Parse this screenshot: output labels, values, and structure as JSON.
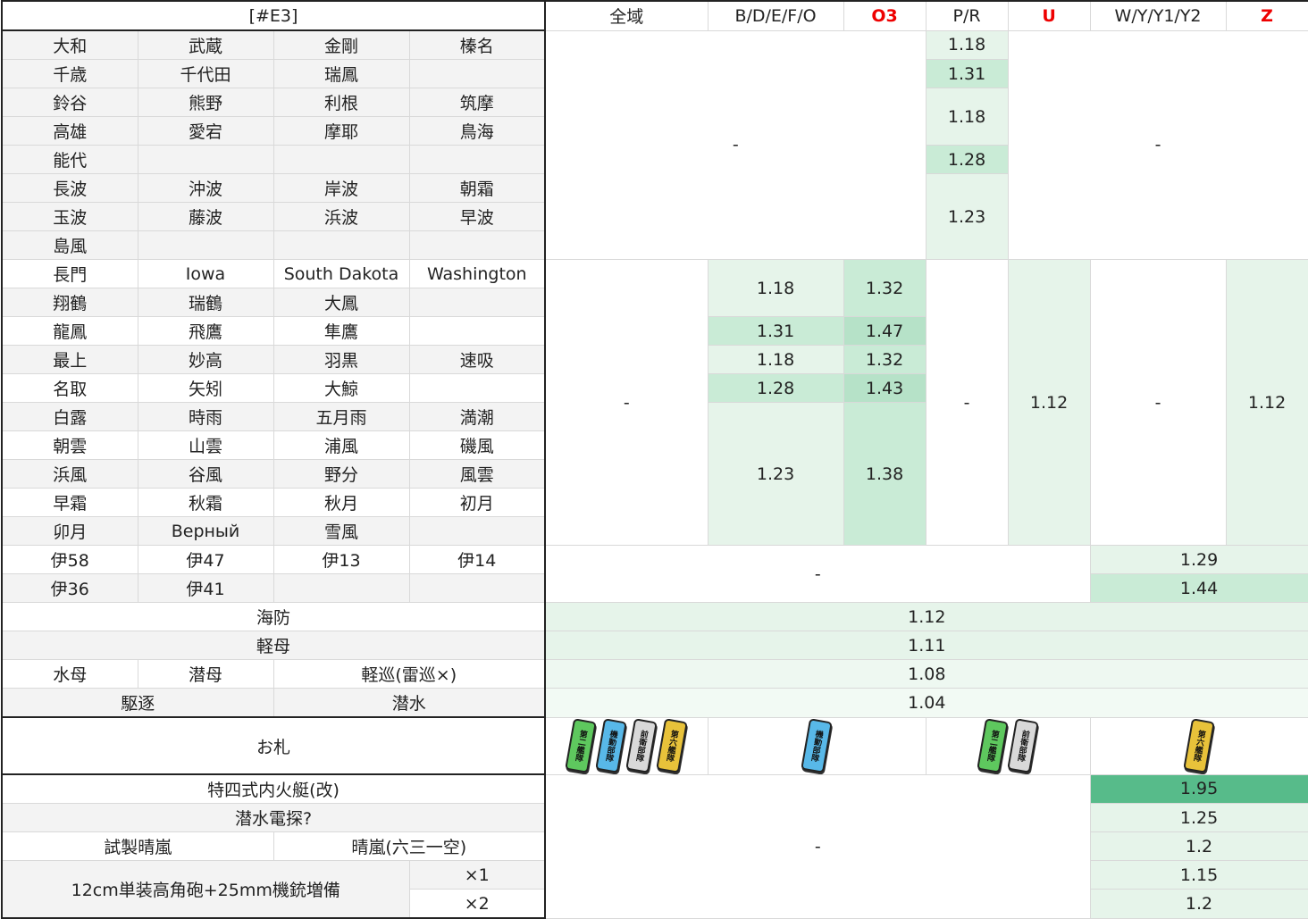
{
  "title": "[#E3]",
  "headers": [
    "全域",
    "B/D/E/F/O",
    "O3",
    "P/R",
    "U",
    "W/Y/Y1/Y2",
    "Z"
  ],
  "ships": [
    [
      "大和",
      "武蔵",
      "金剛",
      "榛名"
    ],
    [
      "千歳",
      "千代田",
      "瑞鳳",
      ""
    ],
    [
      "鈴谷",
      "熊野",
      "利根",
      "筑摩"
    ],
    [
      "高雄",
      "愛宕",
      "摩耶",
      "鳥海"
    ],
    [
      "能代",
      "",
      "",
      ""
    ],
    [
      "長波",
      "沖波",
      "岸波",
      "朝霜"
    ],
    [
      "玉波",
      "藤波",
      "浜波",
      "早波"
    ],
    [
      "島風",
      "",
      "",
      ""
    ],
    [
      "長門",
      "Iowa",
      "South Dakota",
      "Washington"
    ],
    [
      "翔鶴",
      "瑞鶴",
      "大鳳",
      ""
    ],
    [
      "龍鳳",
      "飛鷹",
      "隼鷹",
      ""
    ],
    [
      "最上",
      "妙高",
      "羽黒",
      "速吸"
    ],
    [
      "名取",
      "矢矧",
      "大鯨",
      ""
    ],
    [
      "白露",
      "時雨",
      "五月雨",
      "満潮"
    ],
    [
      "朝雲",
      "山雲",
      "浦風",
      "磯風"
    ],
    [
      "浜風",
      "谷風",
      "野分",
      "風雲"
    ],
    [
      "早霜",
      "秋霜",
      "秋月",
      "初月"
    ],
    [
      "卯月",
      "Верный",
      "雪風",
      ""
    ],
    [
      "伊58",
      "伊47",
      "伊13",
      "伊14"
    ],
    [
      "伊36",
      "伊41",
      "",
      ""
    ]
  ],
  "dash": "-",
  "group1": {
    "pr": [
      "1.18",
      "1.31",
      "1.18",
      "1.28",
      "1.23"
    ]
  },
  "group2": {
    "bdefo": [
      "1.18",
      "1.31",
      "1.18",
      "1.28",
      "1.23"
    ],
    "o3": [
      "1.32",
      "1.47",
      "1.32",
      "1.43",
      "1.38"
    ],
    "u": "1.12",
    "z": "1.12"
  },
  "group3": {
    "wyz": [
      "1.29",
      "1.44"
    ]
  },
  "types": [
    {
      "label": "海防",
      "value": "1.12"
    },
    {
      "label": "軽母",
      "value": "1.11"
    },
    {
      "labels": [
        "水母",
        "潜母",
        "軽巡(雷巡×)"
      ],
      "value": "1.08"
    },
    {
      "labels": [
        "駆逐",
        "潜水"
      ],
      "value": "1.04"
    }
  ],
  "ofuda": {
    "label": "お札",
    "badges_all": [
      {
        "text": "第二艦隊",
        "color": "#5ec85e"
      },
      {
        "text": "機動部隊",
        "color": "#58b8e8"
      },
      {
        "text": "前衛部隊",
        "color": "#d9d9d9"
      },
      {
        "text": "第六艦隊",
        "color": "#e8c23a"
      }
    ],
    "badges_bdefo": [
      {
        "text": "機動部隊",
        "color": "#58b8e8"
      }
    ],
    "badges_pru": [
      {
        "text": "第二艦隊",
        "color": "#5ec85e"
      },
      {
        "text": "前衛部隊",
        "color": "#d9d9d9"
      }
    ],
    "badges_wyz": [
      {
        "text": "第六艦隊",
        "color": "#e8c23a"
      }
    ]
  },
  "equipment": {
    "tokushi": {
      "label": "特四式内火艇(改)",
      "value": "1.95"
    },
    "sensui": {
      "label": "潜水電探?",
      "value": "1.25"
    },
    "seiran_trial": "試製晴嵐",
    "seiran_631": "晴嵐(六三一空)",
    "seiran_value": "1.2",
    "hig_label": "12cm単装高角砲+25mm機銃増備",
    "hig_x1": "×1",
    "hig_x2": "×2",
    "hig_v1": "1.15",
    "hig_v2": "1.2"
  }
}
